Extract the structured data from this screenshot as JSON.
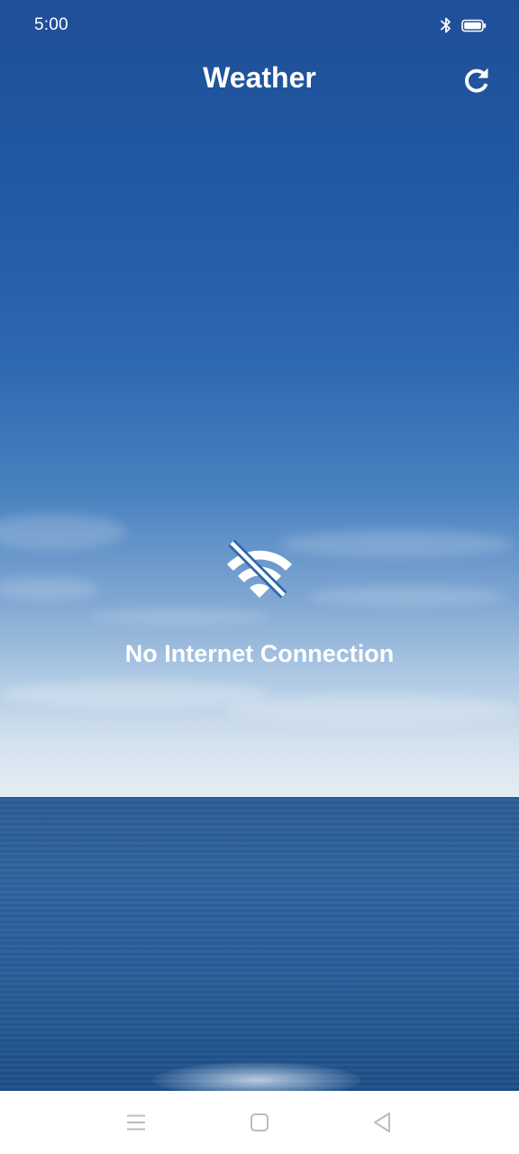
{
  "status_bar": {
    "time": "5:00",
    "icons": [
      "bluetooth-icon",
      "battery-icon"
    ]
  },
  "app_bar": {
    "title": "Weather",
    "refresh_icon": "refresh-icon"
  },
  "main": {
    "icon": "wifi-off-icon",
    "message": "No Internet Connection"
  },
  "nav_bar": {
    "buttons": [
      "menu-icon",
      "home-icon",
      "back-icon"
    ]
  },
  "colors": {
    "sky_top": "#1f4f98",
    "sky_horizon": "#e6edf3",
    "sea": "#2d5c97",
    "text": "#ffffff",
    "nav_icons": "#b8bcc2"
  }
}
